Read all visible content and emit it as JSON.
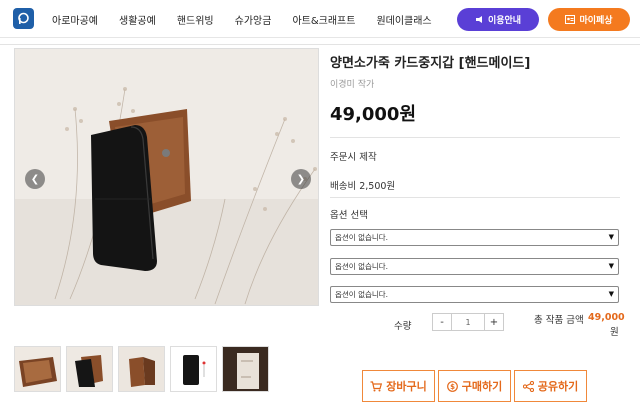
{
  "header": {
    "nav": [
      "아로마공예",
      "생활공예",
      "핸드위빙",
      "슈가앙금",
      "아트&크래프트",
      "원데이클래스"
    ],
    "guide_button": "이용안내",
    "mypage_button": "마이페상"
  },
  "product": {
    "title": "양면소가죽 카드중지갑 [핸드메이드]",
    "author": "이경미 작가",
    "price": "49,000원",
    "production": "주문시 제작",
    "shipping": "배송비 2,500원",
    "option_label": "옵션 선택",
    "options": [
      "옵션이 없습니다.",
      "옵션이 없습니다.",
      "옵션이 없습니다."
    ]
  },
  "quantity": {
    "label": "수량",
    "minus": "-",
    "value": "1",
    "plus": "+"
  },
  "total": {
    "label": "총 작품 금액",
    "value": "49,000",
    "unit": "원"
  },
  "actions": {
    "cart": "장바구니",
    "buy": "구매하기",
    "share": "공유하기"
  },
  "colors": {
    "brand_purple": "#5a3fd6",
    "brand_orange": "#f47a1f",
    "accent_orange": "#e4691b"
  }
}
